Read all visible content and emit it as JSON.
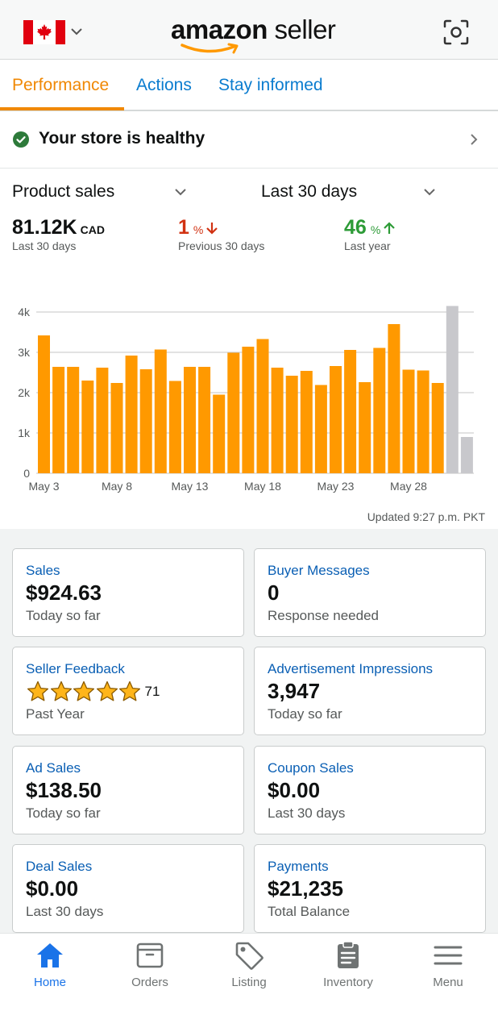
{
  "header": {
    "logo_brand": "amazon",
    "logo_suffix": "seller",
    "country_flag": "canada-flag",
    "scan_icon": "scan-icon"
  },
  "tabs": [
    {
      "label": "Performance",
      "active": true
    },
    {
      "label": "Actions",
      "active": false
    },
    {
      "label": "Stay informed",
      "active": false
    }
  ],
  "health": {
    "label": "Your store is healthy"
  },
  "selectors": {
    "metric": "Product sales",
    "period": "Last 30 days"
  },
  "summary": {
    "value": "81.12K",
    "unit": "CAD",
    "value_caption": "Last 30 days",
    "prev_change": "1",
    "prev_change_unit": "%",
    "prev_caption": "Previous 30 days",
    "year_change": "46",
    "year_change_unit": "%",
    "year_caption": "Last year"
  },
  "chart_data": {
    "type": "bar",
    "xlabel": "",
    "ylabel": "",
    "ylim": [
      0,
      4000
    ],
    "y_ticks": [
      "0",
      "1k",
      "2k",
      "3k",
      "4k"
    ],
    "x_tick_labels": [
      "May 3",
      "May 8",
      "May 13",
      "May 18",
      "May 23",
      "May 28"
    ],
    "colors": {
      "current": "#ff9900",
      "previous": "#c8c8cc",
      "grid": "#c6c6c6"
    },
    "values": [
      3420,
      2640,
      2640,
      2300,
      2620,
      2240,
      2920,
      2580,
      3070,
      2290,
      2640,
      2640,
      1950,
      2990,
      3140,
      3330,
      2620,
      2420,
      2540,
      2190,
      2660,
      3060,
      2260,
      3110,
      3700,
      2570,
      2550,
      2240
    ],
    "comparison_values": [
      4150,
      900
    ]
  },
  "updated": "Updated 9:27 p.m. PKT",
  "cards": [
    {
      "title": "Sales",
      "value": "$924.63",
      "sub": "Today so far"
    },
    {
      "title": "Buyer Messages",
      "value": "0",
      "sub": "Response needed"
    },
    {
      "title": "Seller Feedback",
      "rating": 5,
      "count": "71",
      "sub": "Past Year"
    },
    {
      "title": "Advertisement Impressions",
      "value": "3,947",
      "sub": "Today so far"
    },
    {
      "title": "Ad Sales",
      "value": "$138.50",
      "sub": "Today so far"
    },
    {
      "title": "Coupon Sales",
      "value": "$0.00",
      "sub": "Last 30 days"
    },
    {
      "title": "Deal Sales",
      "value": "$0.00",
      "sub": "Last 30 days"
    },
    {
      "title": "Payments",
      "value": "$21,235",
      "sub": "Total Balance"
    }
  ],
  "bottom_nav": [
    {
      "label": "Home",
      "icon": "home-icon",
      "active": true
    },
    {
      "label": "Orders",
      "icon": "box-icon",
      "active": false
    },
    {
      "label": "Listing",
      "icon": "tag-icon",
      "active": false
    },
    {
      "label": "Inventory",
      "icon": "clipboard-icon",
      "active": false
    },
    {
      "label": "Menu",
      "icon": "hamburger-icon",
      "active": false
    }
  ]
}
